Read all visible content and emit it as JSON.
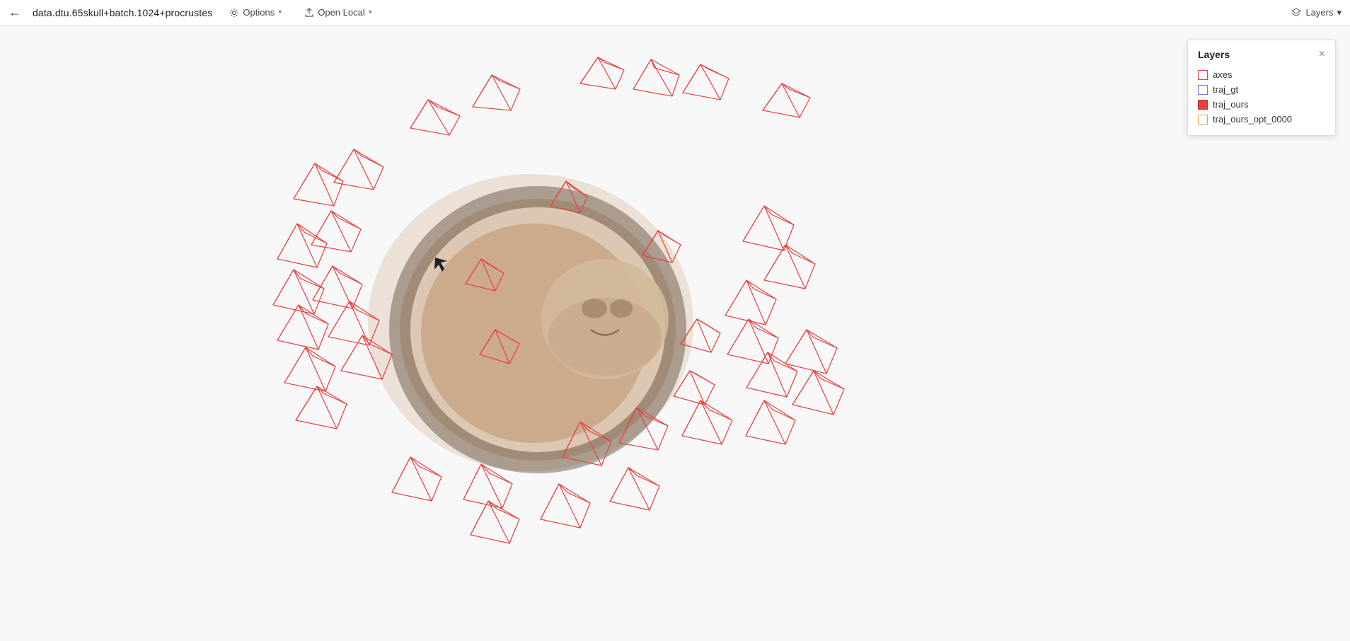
{
  "header": {
    "back_icon": "←",
    "title": "data.dtu.65skull+batch.1024+procrustes",
    "options_label": "Options",
    "open_local_label": "Open Local",
    "layers_label": "Layers",
    "chevron": "▾"
  },
  "layers_panel": {
    "title": "Layers",
    "close": "×",
    "items": [
      {
        "id": "axes",
        "label": "axes",
        "color": "#e84040",
        "border": "#c03030",
        "filled": false
      },
      {
        "id": "traj_gt",
        "label": "traj_gt",
        "color": "#ffffff",
        "border": "#7777cc",
        "filled": false
      },
      {
        "id": "traj_ours",
        "label": "traj_ours",
        "color": "#e84040",
        "border": "#c03030",
        "filled": true
      },
      {
        "id": "traj_ours_opt_0000",
        "label": "traj_ours_opt_0000",
        "color": "#ffffff",
        "border": "#e8a040",
        "filled": false
      }
    ]
  },
  "viewport": {
    "camera_pyramids_color": "#e84040"
  }
}
